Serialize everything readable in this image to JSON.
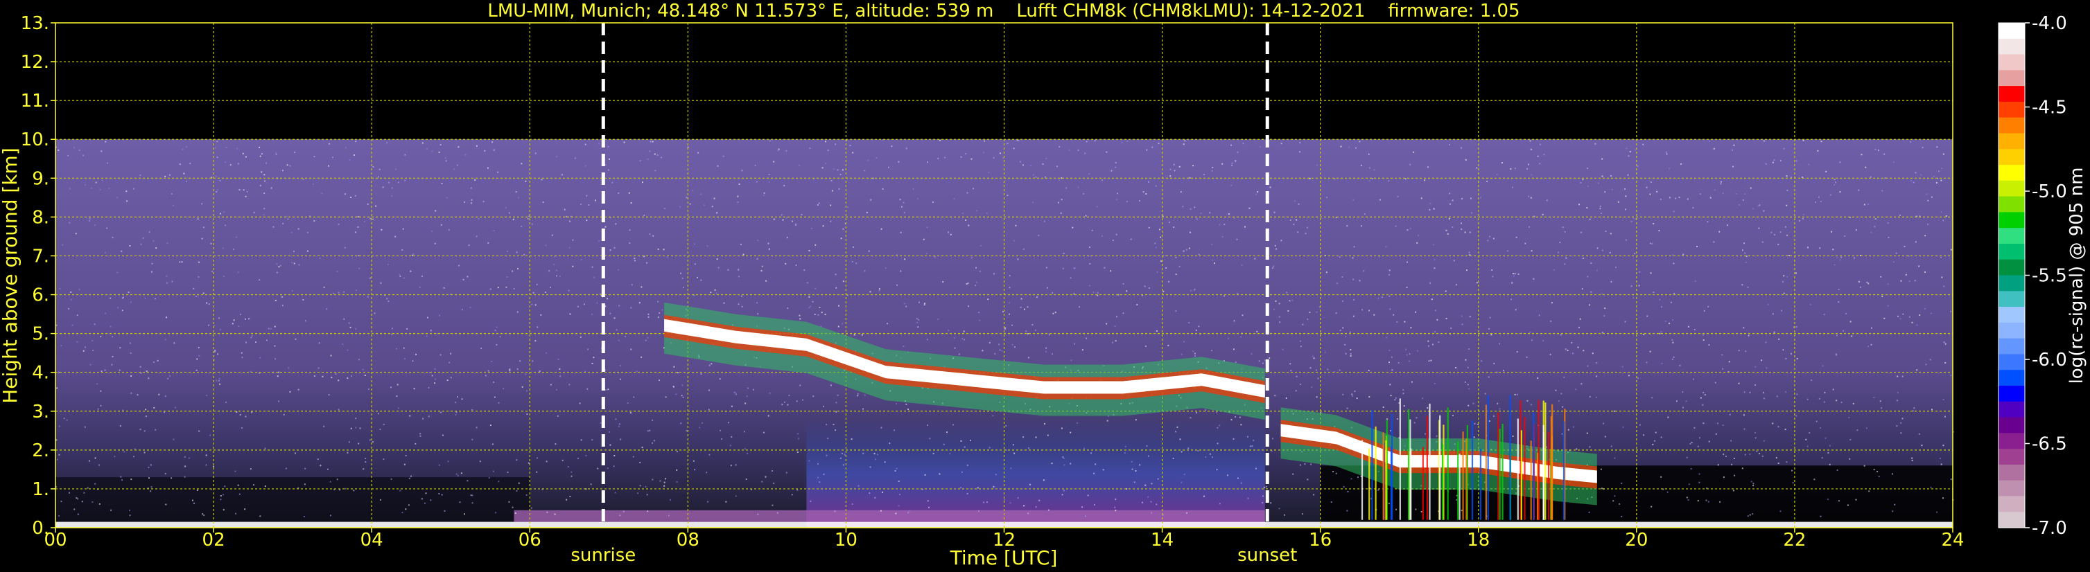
{
  "chart_data": {
    "type": "heatmap",
    "title": "LMU-MIM, Munich; 48.148° N 11.573° E, altitude: 539 m    Lufft CHM8k (CHM8kLMU): 14-12-2021    firmware: 1.05",
    "xlabel": "Time [UTC]",
    "ylabel": "Height above ground [km]",
    "xlim": [
      0,
      24
    ],
    "ylim": [
      0,
      13
    ],
    "x_ticks": [
      "00",
      "02",
      "04",
      "06",
      "08",
      "10",
      "12",
      "14",
      "16",
      "18",
      "20",
      "22",
      "24"
    ],
    "y_ticks": [
      "0.",
      "1.",
      "2.",
      "3.",
      "4.",
      "5.",
      "6.",
      "7.",
      "8.",
      "9.",
      "10.",
      "11.",
      "12.",
      "13."
    ],
    "grid": true,
    "measurement_top_km": 10,
    "event_lines": [
      {
        "label": "sunrise",
        "x": 6.93
      },
      {
        "label": "sunset",
        "x": 15.33
      }
    ],
    "colorbar": {
      "label": "log(rc-signal) @ 905 nm",
      "range": [
        -7.0,
        -4.0
      ],
      "ticks": [
        "-4.0",
        "-4.5",
        "-5.0",
        "-5.5",
        "-6.0",
        "-6.5",
        "-7.0"
      ],
      "colors": [
        "#ffffff",
        "#f2e6e6",
        "#f0c8c8",
        "#e6a0a0",
        "#ff0000",
        "#ff4000",
        "#ff8000",
        "#ffb000",
        "#ffd000",
        "#ffff00",
        "#c8f000",
        "#80e000",
        "#00d000",
        "#30e080",
        "#00c070",
        "#009040",
        "#00a080",
        "#40c0c0",
        "#a0c8ff",
        "#8cb4ff",
        "#6496ff",
        "#3c78ff",
        "#0050ff",
        "#0000ff",
        "#5000c0",
        "#6a0090",
        "#8a2090",
        "#a04090",
        "#b070a0",
        "#c090b0",
        "#d0b0c0",
        "#d8c8d0"
      ]
    },
    "cloud_layers": [
      {
        "name": "upper",
        "points": [
          [
            7.7,
            5.3
          ],
          [
            8.6,
            5.0
          ],
          [
            9.5,
            4.8
          ],
          [
            10.5,
            4.1
          ],
          [
            11.5,
            3.9
          ],
          [
            12.5,
            3.7
          ],
          [
            13.5,
            3.7
          ],
          [
            14.5,
            3.9
          ],
          [
            15.3,
            3.6
          ]
        ]
      },
      {
        "name": "lower",
        "points": [
          [
            15.5,
            2.6
          ],
          [
            16.2,
            2.4
          ],
          [
            17.0,
            1.8
          ],
          [
            18.0,
            1.8
          ],
          [
            19.0,
            1.5
          ],
          [
            19.5,
            1.4
          ]
        ]
      }
    ]
  }
}
